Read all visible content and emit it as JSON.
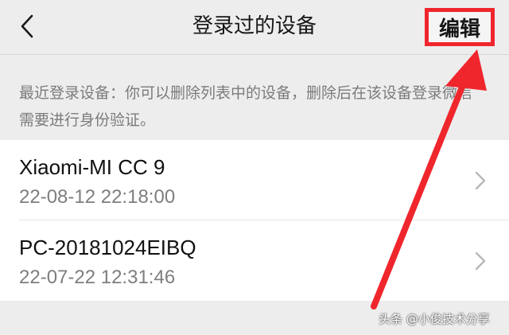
{
  "header": {
    "title": "登录过的设备",
    "edit_label": "编辑"
  },
  "notice": "最近登录设备：你可以删除列表中的设备，删除后在该设备登录微信需要进行身份验证。",
  "devices": [
    {
      "name": "Xiaomi-MI CC 9",
      "time": "22-08-12 22:18:00"
    },
    {
      "name": "PC-20181024EIBQ",
      "time": "22-07-22 12:31:46"
    }
  ],
  "watermark": "头条 @小俊技术分享",
  "colors": {
    "highlight": "#f0262d",
    "background": "#ededed"
  }
}
